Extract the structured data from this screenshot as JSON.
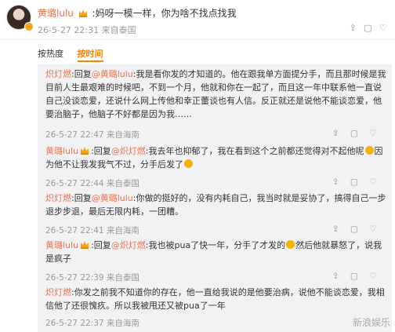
{
  "post": {
    "user": "黄璐lulu",
    "text": ":妈呀一模一样，你为啥不找点找我",
    "time": "26-5-27 22:31",
    "source": "来自泰国"
  },
  "tabs": [
    {
      "label": "按热度",
      "active": false
    },
    {
      "label": "按时间",
      "active": true
    }
  ],
  "replies": [
    {
      "user": "炽灯燃",
      "reply_prefix": ":回复",
      "mention": "@黄璐lulu",
      "text": ":我是看你发的才知道的。他在跟我单方面提分手，而且那时候是我目前人生最艰难的时候吧，不到一个月，他就和你在一起了，而且这一年中联系他一直说自己没谈恋爱，还说什么网上传他和幸正蕾谈也有人信。反正就还是说他不能谈恋爱，他要治脑子，他脑子不好都是因为我……",
      "time": "26-5-27 22:47",
      "source": "来自海南"
    },
    {
      "user": "黄璐lulu",
      "reply_prefix": ":回复",
      "mention": "@炽灯燃",
      "text_a": ":我去年也抑郁了，我在看到这个之前都还觉得对不起他呢",
      "text_b": "因为他不让我发我气不过，分手后发了",
      "time": "26-5-27 22:44",
      "source": "来自泰国"
    },
    {
      "user": "炽灯燃",
      "reply_prefix": ":回复",
      "mention": "@黄璐lulu",
      "text": ":你做的挺好的，没有内耗自己，我当时就是妥协了，搞得自己一步退步步退，最后无限内耗，一团糟。",
      "time": "26-5-27 22:41",
      "source": "来自海南"
    },
    {
      "user": "黄璐lulu",
      "reply_prefix": ":回复",
      "mention": "@炽灯燃",
      "text_a": ":我也被pua了快一年，分手了才发的",
      "text_b": "然后他就暴怒了，说我是疯子",
      "time": "26-5-27 22:39",
      "source": "来自泰国"
    },
    {
      "user": "炽灯燃",
      "reply_prefix": "",
      "mention": "",
      "text": ":你发之前我不知道你的存在，他一直给我说的是他要治病，说他不能谈恋爱，我相信他了还很愧疚。所以我被甩还又被pua了一年",
      "time": "26-5-27 22:37",
      "source": "来自海南"
    }
  ],
  "actions": {
    "share": "⇪",
    "comment": "▢",
    "like": "♡"
  },
  "watermark": "新浪娱乐",
  "colors": {
    "username": "#eb7350",
    "active_tab": "#ff8200",
    "panel": "#f2f2f5"
  }
}
